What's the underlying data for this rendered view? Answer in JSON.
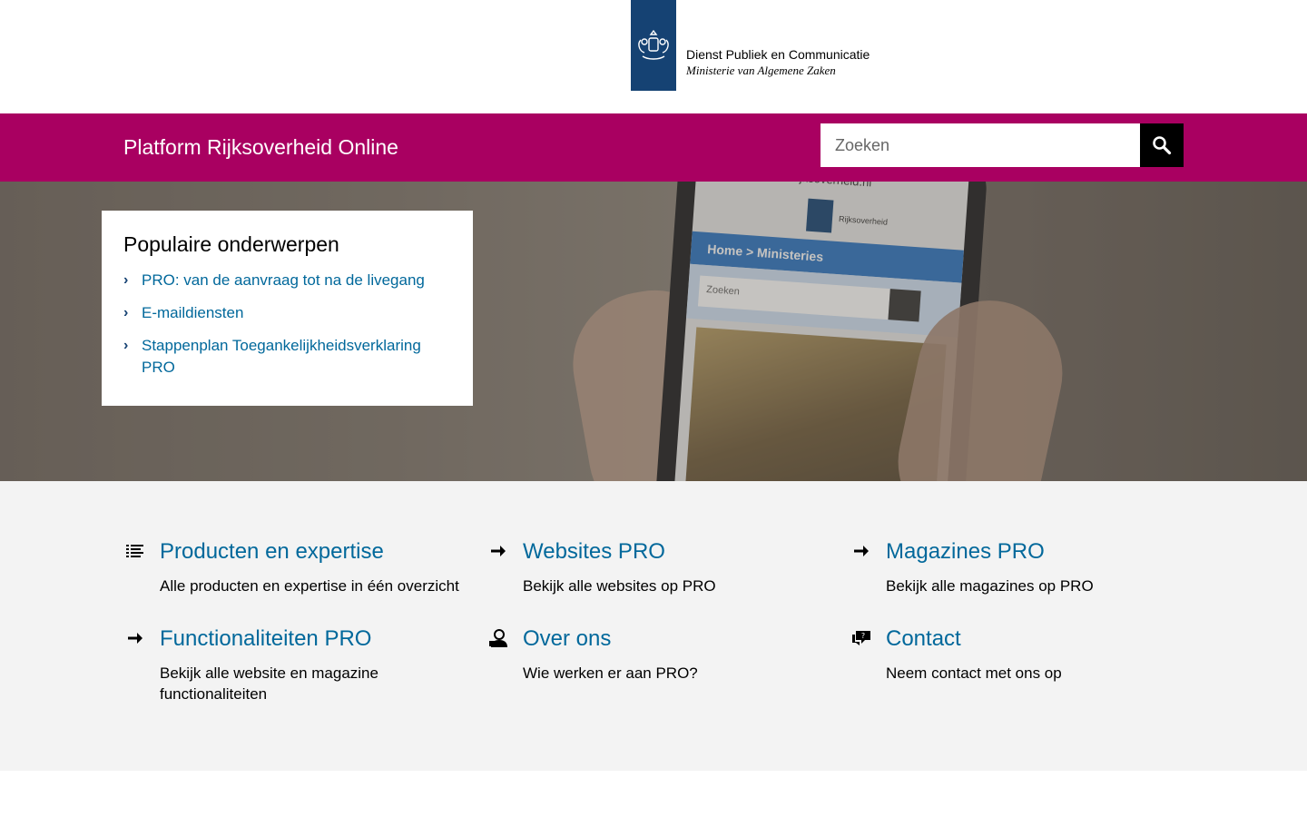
{
  "header": {
    "logo_line1": "Dienst Publiek en Communicatie",
    "logo_line2": "Ministerie van Algemene Zaken"
  },
  "navbar": {
    "site_title": "Platform Rijksoverheid Online",
    "search_placeholder": "Zoeken",
    "search_icon": "search-icon"
  },
  "hero": {
    "phone_url": "rijksoverheid.nl",
    "phone_brand": "Rijksoverheid",
    "phone_nav": "Home > Ministeries",
    "phone_search": "Zoeken"
  },
  "popular": {
    "title": "Populaire onderwerpen",
    "items": [
      {
        "label": "PRO: van de aanvraag tot na de livegang"
      },
      {
        "label": "E-maildiensten"
      },
      {
        "label": "Stappenplan Toegankelijkheidsverklaring PRO"
      }
    ]
  },
  "tiles": [
    {
      "title": "Producten en expertise",
      "description": "Alle producten en expertise in één overzicht",
      "icon": "list-icon"
    },
    {
      "title": "Websites PRO",
      "description": "Bekijk alle websites op PRO",
      "icon": "arrow-right-icon"
    },
    {
      "title": "Magazines PRO",
      "description": "Bekijk alle magazines op PRO",
      "icon": "arrow-right-icon"
    },
    {
      "title": "Functionaliteiten PRO",
      "description": "Bekijk alle website en magazine functionaliteiten",
      "icon": "arrow-right-icon"
    },
    {
      "title": "Over ons",
      "description": "Wie werken er aan PRO?",
      "icon": "person-icon"
    },
    {
      "title": "Contact",
      "description": "Neem contact met ons op",
      "icon": "chat-icon"
    }
  ],
  "colors": {
    "brand": "#a90061",
    "logo_blue": "#154273",
    "link": "#01689b",
    "tiles_bg": "#f3f3f3"
  }
}
